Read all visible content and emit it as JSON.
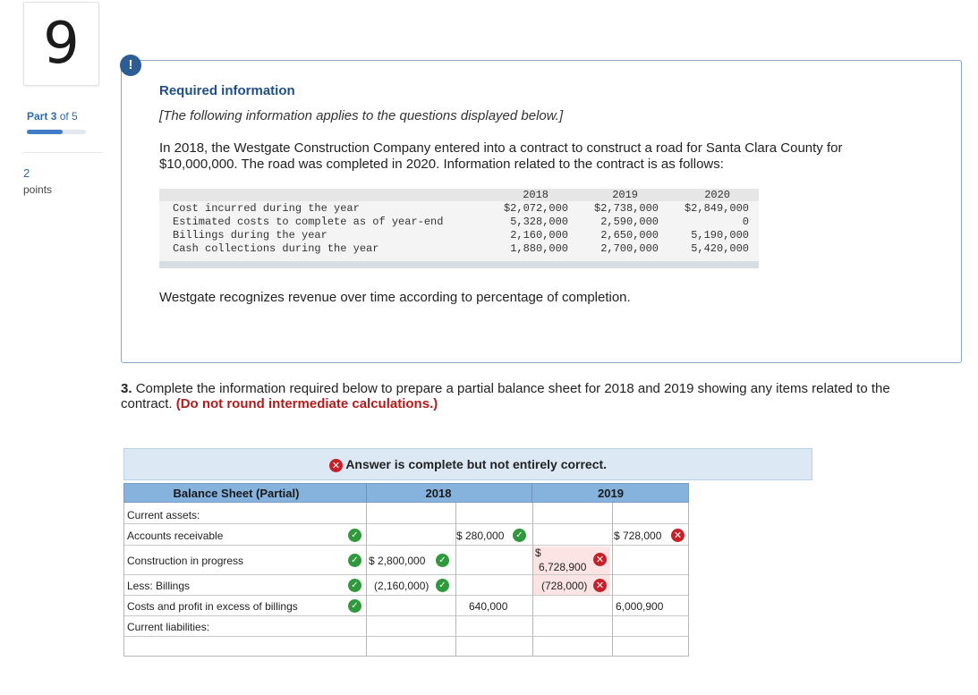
{
  "sidebar": {
    "question_number": "9",
    "part_label": "Part",
    "part_current": "3",
    "part_of": "of 5",
    "progress_fraction": 0.6,
    "points_value": "2",
    "points_label": "points"
  },
  "info": {
    "alert_glyph": "!",
    "title": "Required information",
    "applies": "[The following information applies to the questions displayed below.]",
    "paragraph": "In 2018, the Westgate Construction Company entered into a contract to construct a road for Santa Clara County for $10,000,000. The road was completed in 2020. Information related to the contract is as follows:",
    "table": {
      "years": [
        "2018",
        "2019",
        "2020"
      ],
      "rows": [
        {
          "label": "Cost incurred during the year",
          "values": [
            "$2,072,000",
            "$2,738,000",
            "$2,849,000"
          ]
        },
        {
          "label": "Estimated costs to complete as of year-end",
          "values": [
            "5,328,000",
            "2,590,000",
            "0"
          ]
        },
        {
          "label": "Billings during the year",
          "values": [
            "2,160,000",
            "2,650,000",
            "5,190,000"
          ]
        },
        {
          "label": "Cash collections during the year",
          "values": [
            "1,880,000",
            "2,700,000",
            "5,420,000"
          ]
        }
      ]
    },
    "revenue_note": "Westgate recognizes revenue over time according to percentage of completion."
  },
  "question": {
    "number": "3.",
    "text": "Complete the information required below to prepare a partial balance sheet for 2018 and 2019 showing any items related to the contract.",
    "note": "(Do not round intermediate calculations.)"
  },
  "banner": {
    "text": "Answer is complete but not entirely correct."
  },
  "balance_sheet": {
    "header": {
      "label": "Balance Sheet (Partial)",
      "y1": "2018",
      "y2": "2019"
    },
    "rows": {
      "current_assets": "Current assets:",
      "accounts_receivable": "Accounts receivable",
      "construction_in_progress": "Construction in progress",
      "less_billings": "Less: Billings",
      "costs_profit_excess": "Costs and profit in excess of billings",
      "current_liabilities": "Current liabilities:"
    },
    "values": {
      "ar_2018": "$ 280,000",
      "ar_2019": "$ 728,000",
      "cip_2018": "$ 2,800,000",
      "cip_2019_symbol": "$",
      "cip_2019": "6,728,900",
      "billings_2018": "(2,160,000)",
      "billings_2019": "(728,000)",
      "excess_2018": "640,000",
      "excess_2019": "6,000,900"
    }
  },
  "icons": {
    "check": "check-icon",
    "x": "x-icon"
  },
  "colors": {
    "accent": "#2d5d95",
    "correct": "#2f9a3b",
    "incorrect": "#c8202a",
    "header": "#86b2de"
  }
}
